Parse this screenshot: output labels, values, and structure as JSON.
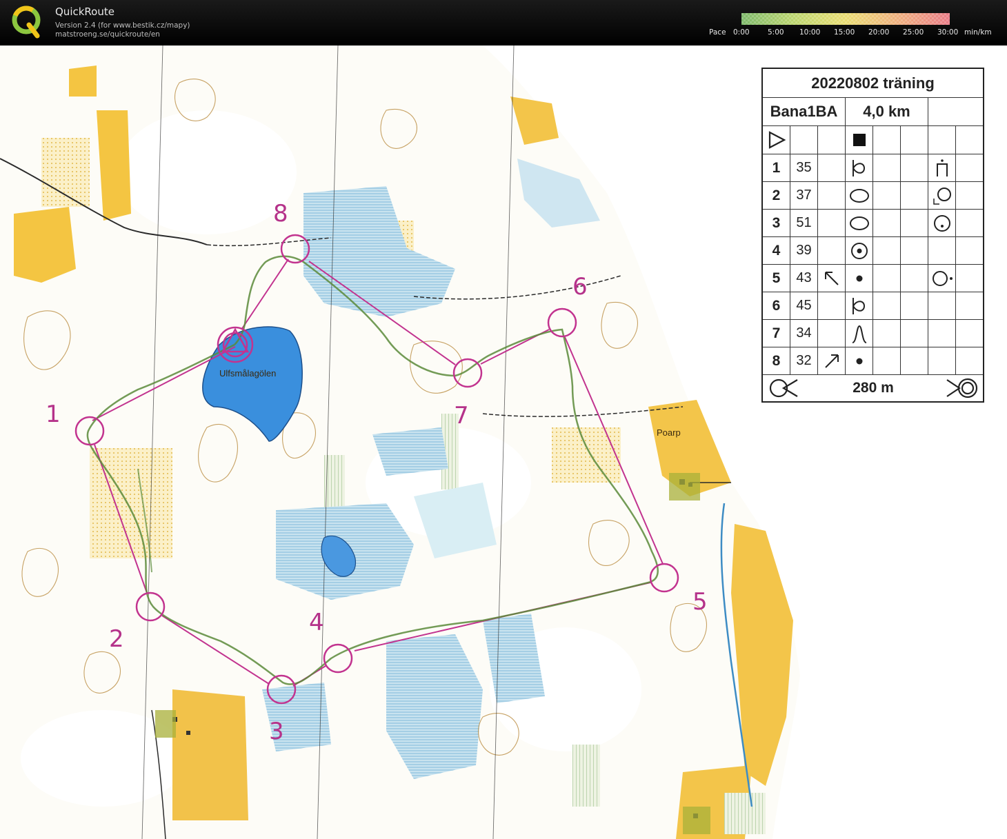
{
  "app": {
    "name": "QuickRoute",
    "version_line": "Version 2.4  (for www.bestik.cz/mapy)",
    "url_line": "matstroeng.se/quickroute/en"
  },
  "pace_legend": {
    "label": "Pace",
    "ticks": [
      "0:00",
      "5:00",
      "10:00",
      "15:00",
      "20:00",
      "25:00",
      "30:00"
    ],
    "unit": "min/km",
    "colors": [
      "#7db96a",
      "#bcd66e",
      "#eadd72",
      "#efb07e",
      "#e97b86"
    ]
  },
  "map": {
    "lake_name": "Ulfsmålagölen",
    "farm_name": "Poarp",
    "course_color": "#c2338f",
    "route_color": "#5a8a3a",
    "control_numbers": [
      "1",
      "2",
      "3",
      "4",
      "5",
      "6",
      "7",
      "8"
    ]
  },
  "course_card": {
    "title": "20220802 träning",
    "course_name": "Bana1BA",
    "length": "4,0 km",
    "rows": [
      {
        "num": "1",
        "code": "35"
      },
      {
        "num": "2",
        "code": "37"
      },
      {
        "num": "3",
        "code": "51"
      },
      {
        "num": "4",
        "code": "39"
      },
      {
        "num": "5",
        "code": "43"
      },
      {
        "num": "6",
        "code": "45"
      },
      {
        "num": "7",
        "code": "34"
      },
      {
        "num": "8",
        "code": "32"
      }
    ],
    "finish_distance": "280 m"
  }
}
